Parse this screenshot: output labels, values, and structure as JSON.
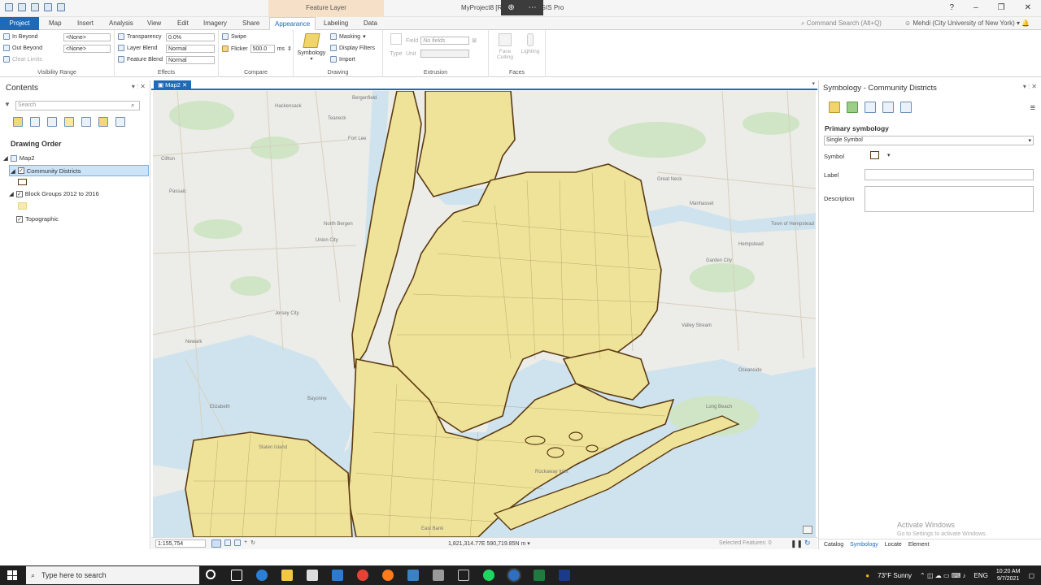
{
  "window": {
    "title": "MyProject8 [Re...   ...p2 - ArcGIS Pro",
    "context_band": "Feature Layer",
    "buttons": [
      "?",
      "–",
      "❐",
      "✕"
    ]
  },
  "ribbon_tabs": [
    "Project",
    "Map",
    "Insert",
    "Analysis",
    "View",
    "Edit",
    "Imagery",
    "Share",
    "Appearance",
    "Labeling",
    "Data"
  ],
  "command_search": "Command Search (Alt+Q)",
  "user": "Mehdi (City University of New York)",
  "ribbon": {
    "visibility": {
      "in_beyond": "In Beyond",
      "out_beyond": "Out Beyond",
      "in_value": "<None>",
      "out_value": "<None>",
      "clear": "Clear Limits",
      "label": "Visibility Range"
    },
    "effects": {
      "transparency": "Transparency",
      "transparency_value": "0.0%",
      "layer_blend": "Layer Blend",
      "layer_blend_value": "Normal",
      "feature_blend": "Feature Blend",
      "feature_blend_value": "Normal",
      "label": "Effects"
    },
    "compare": {
      "swipe": "Swipe",
      "flicker": "Flicker",
      "flicker_value": "500.0",
      "flicker_unit": "ms",
      "label": "Compare"
    },
    "drawing": {
      "symbology": "Symbology",
      "masking": "Masking",
      "display_filters": "Display Filters",
      "import": "Import",
      "label": "Drawing"
    },
    "extrusion": {
      "type": "Type",
      "field": "Field",
      "field_value": "No fields",
      "unit": "Unit",
      "label": "Extrusion"
    },
    "faces": {
      "face_culling": "Face Culling",
      "lighting": "Lighting",
      "label": "Faces"
    }
  },
  "contents": {
    "title": "Contents",
    "search_placeholder": "Search",
    "drawing_order": "Drawing Order",
    "map": "Map2",
    "layers": [
      "Community Districts",
      "Block Groups 2012 to 2016",
      "Topographic"
    ]
  },
  "map": {
    "tab": "Map2",
    "scale": "1:155,754",
    "coords": "1,821,314.77E 590,719.85N m",
    "selected": "Selected Features: 0",
    "labels": [
      "Hackensack",
      "Teaneck",
      "Fort Lee",
      "Bergenfield",
      "Clifton",
      "Passaic",
      "North Bergen",
      "Union City",
      "Jersey City",
      "Newark",
      "Bayonne",
      "Elizabeth",
      "Staten Island",
      "Great Neck",
      "Manhasset",
      "Valley Stream",
      "Hempstead",
      "Town of Hempstead",
      "Garden City",
      "Oceanside",
      "Long Beach",
      "Rockaway Inlet",
      "East Bank"
    ]
  },
  "symbology": {
    "title": "Symbology - Community Districts",
    "primary": "Primary symbology",
    "type_value": "Single Symbol",
    "symbol": "Symbol",
    "label": "Label",
    "description": "Description",
    "tabs": [
      "Catalog",
      "Symbology",
      "Locate",
      "Element"
    ]
  },
  "activate": {
    "title": "Activate Windows",
    "sub": "Go to Settings to activate Windows."
  },
  "taskbar": {
    "search": "Type here to search",
    "weather": "73°F  Sunny",
    "lang": "ENG",
    "time": "10:20 AM",
    "date": "9/7/2021"
  },
  "colors": {
    "accent": "#1d6ab8",
    "district_fill": "#efe39a",
    "district_line": "#5b3b12",
    "water": "#cfe3ef",
    "land": "#ecece8"
  }
}
